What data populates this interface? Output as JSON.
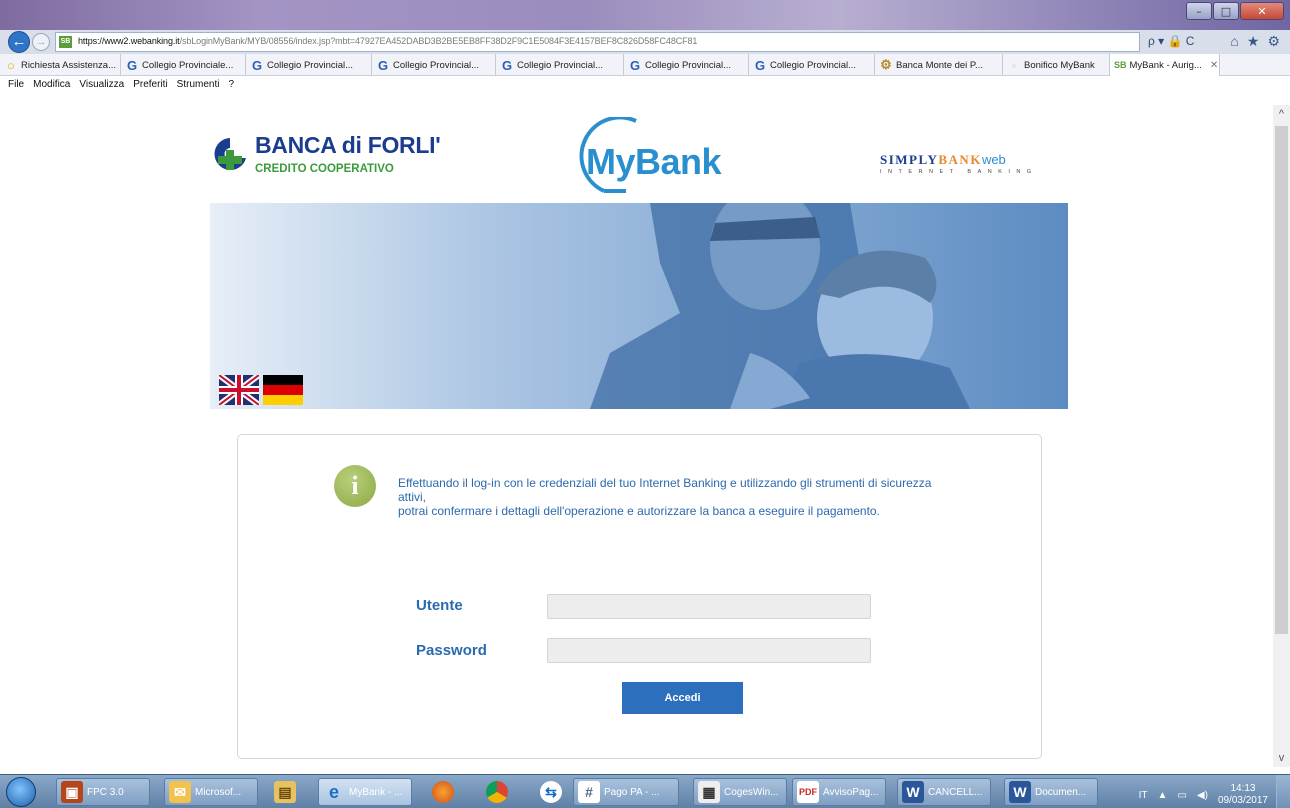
{
  "browser": {
    "url_host": "https://www2.webanking.it",
    "url_path": "/sbLoginMyBank/MYB/08556/index.jsp?mbt=47927EA452DABD3B2BE5EB8FF38D2F9C1E5084F3E4157BEF8C826D58FC48CF81",
    "site_badge": "SB",
    "addr_tools": "ρ ▾ 🔒 C",
    "tabs": [
      {
        "label": "Richiesta Assistenza...",
        "icon": "circle-icon"
      },
      {
        "label": "Collegio Provinciale...",
        "icon": "g-icon"
      },
      {
        "label": "Collegio Provincial...",
        "icon": "g-icon"
      },
      {
        "label": "Collegio Provincial...",
        "icon": "g-icon"
      },
      {
        "label": "Collegio Provincial...",
        "icon": "g-icon"
      },
      {
        "label": "Collegio Provincial...",
        "icon": "g-icon"
      },
      {
        "label": "Collegio Provincial...",
        "icon": "g-icon"
      },
      {
        "label": "Banca Monte dei P...",
        "icon": "gear-icon"
      },
      {
        "label": "Bonifico MyBank",
        "icon": "blank-icon"
      },
      {
        "label": "MyBank - Aurig...",
        "icon": "sb-icon",
        "active": true
      }
    ],
    "menu": [
      "File",
      "Modifica",
      "Visualizza",
      "Preferiti",
      "Strumenti",
      "?"
    ]
  },
  "page": {
    "bank_name": "BANCA di FORLI'",
    "bank_tagline": "CREDITO COOPERATIVO",
    "mybank_logo": "MyBank",
    "simply_part1": "SIMPLY",
    "simply_part2": "BANK",
    "simply_part3": "web",
    "simply_sub": "INTERNET BANKING",
    "info_icon": "i",
    "info_line1": "Effettuando il log-in con le credenziali del tuo Internet Banking e utilizzando gli strumenti di sicurezza",
    "info_line2": "attivi,",
    "info_line3": "potrai confermare i dettagli dell'operazione e autorizzare la banca a eseguire il pagamento.",
    "user_label": "Utente",
    "password_label": "Password",
    "user_value": "",
    "password_value": "",
    "submit_label": "Accedi"
  },
  "taskbar": {
    "items": [
      {
        "label": "FPC 3.0",
        "icon": "gift-icon"
      },
      {
        "label": "Microsof...",
        "icon": "outlook-icon"
      },
      {
        "label": "",
        "icon": "file-explorer-icon"
      },
      {
        "label": "MyBank - ...",
        "icon": "internet-explorer-icon"
      },
      {
        "label": "",
        "icon": "firefox-icon"
      },
      {
        "label": "",
        "icon": "chrome-icon"
      },
      {
        "label": "",
        "icon": "teamviewer-icon"
      },
      {
        "label": "Pago PA - ...",
        "icon": "hashtag-icon"
      },
      {
        "label": "CogesWin...",
        "icon": "app-icon"
      },
      {
        "label": "AvvisoPag...",
        "icon": "pdf-icon"
      },
      {
        "label": "CANCELL...",
        "icon": "word-icon"
      },
      {
        "label": "Documen...",
        "icon": "word-icon"
      }
    ],
    "lang": "IT",
    "time": "14:13",
    "date": "09/03/2017"
  },
  "colors": {
    "brand_blue": "#2c6aae",
    "button_blue": "#2c6fbc",
    "bank_green": "#3b9b3c",
    "mybank_blue": "#2a8fcf"
  }
}
